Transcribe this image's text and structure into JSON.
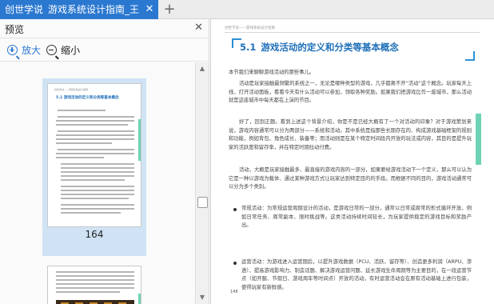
{
  "tabbar": {
    "tab_title_part1": "创世学说",
    "tab_title_part2": "游戏系统设计指南_王",
    "close_glyph": "✕",
    "add_glyph": "+"
  },
  "preview_pane": {
    "title": "预览",
    "close_glyph": "✕",
    "zoom_in_label": "放大",
    "zoom_out_label": "缩小",
    "thumbnail_page_number": "164",
    "thumb_title": "5.1  游戏活动的定义和分类等基本概念"
  },
  "document": {
    "running_header": "创世学说——游戏系统设计指南",
    "section_number": "5.1",
    "section_title": "游戏活动的定义和分类等基本概念",
    "paragraphs": [
      "本节我们来聊聊游戏活动的那些事儿。",
      "活动是玩家接触最频繁的系统之一，无论是哪种类型的游戏，几乎都离不开“活动”这个概念。玩家每天上线，打开活动面板，看看今天有什么活动可以参加，领取各种奖励。如果我们把游戏比作一座城市，那么活动就是这座城市中每天都在上演的节目。",
      "好了，回到正题。看到上述这个背景介绍，你是不是已经大概有了一个对活动的印象？对于游戏策划来说，游戏内容通常可以分为两部分——系统和活动。其中系统是指那些长期存在的、构成游戏基础框架的规则和功能，例如背包、角色成长、装备等；而活动则是在某个特定时间段内开放的玩法或内容，其目的是提升玩家的活跃度和留存率，并在特定时期拉动付费。",
      "活动，大概是玩家接触最多、最直接的游戏内容的一部分，如果要给游戏活动下一个定义，那么可以认为它是一种以游戏为载体、通过某种游戏方式让玩家达到特定目的的手段。而根据不同的目的，游戏活动通常可以分为多个类别。",
      "常规活动：为常规运营周期设计的活动，是游戏日常的一部分，通常以日常或周常的形式循环开放，例如日常任务、周常副本、限时挑战等。这类活动持续时间较长，为玩家提供稳定的游戏目标和奖励产出。",
      "运营活动：为游戏进入运营期后，以提升游戏数据（PCU、活跃、留存等）、创造更多利润（ARPU、渗透）、提高游戏影响力、制造话题、解决游戏运营问题、延长游戏生命周期等为主要目的，在一段运营节点（如开服、节假日、游戏周年等时间点）开放的活动，有时运营活动会在原有活动基础上进行包装，使得玩家有新鲜感。"
    ],
    "page_number": "148"
  }
}
